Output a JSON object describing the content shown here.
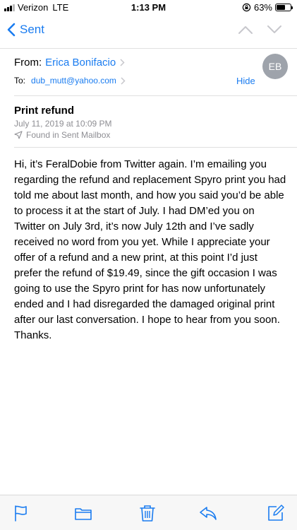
{
  "status_bar": {
    "carrier": "Verizon",
    "network": "LTE",
    "time": "1:13 PM",
    "battery_percent": "63%",
    "battery_level": 0.63
  },
  "nav": {
    "back_label": "Sent"
  },
  "header": {
    "from_label": "From:",
    "from_name": "Erica Bonifacio",
    "to_label": "To:",
    "to_address": "dub_mutt@yahoo.com",
    "hide_label": "Hide",
    "avatar_initials": "EB"
  },
  "message": {
    "subject": "Print refund",
    "date": "July 11, 2019 at 10:09 PM",
    "mailbox": "Found in Sent Mailbox",
    "body": "Hi, it’s FeralDobie from Twitter again. I’m emailing you regarding the refund and replacement Spyro print you had told me about last month, and how you said you’d be able to process it at the start of July. I had DM’ed you on Twitter on July 3rd, it’s now July 12th and I’ve sadly received no word from you yet. While I appreciate your offer of a refund and a new print, at this point I’d just prefer the refund of $19.49, since the gift occasion I was going to use the Spyro print for has now unfortunately ended and I had disregarded the damaged original print after our last conversation. I hope to hear from you soon. Thanks."
  },
  "colors": {
    "accent": "#1a7cf0",
    "secondary_text": "#8e8e93",
    "avatar_bg": "#9ea3ab"
  },
  "icons": {
    "toolbar": [
      "flag-icon",
      "folder-icon",
      "trash-icon",
      "reply-icon",
      "compose-icon"
    ]
  }
}
